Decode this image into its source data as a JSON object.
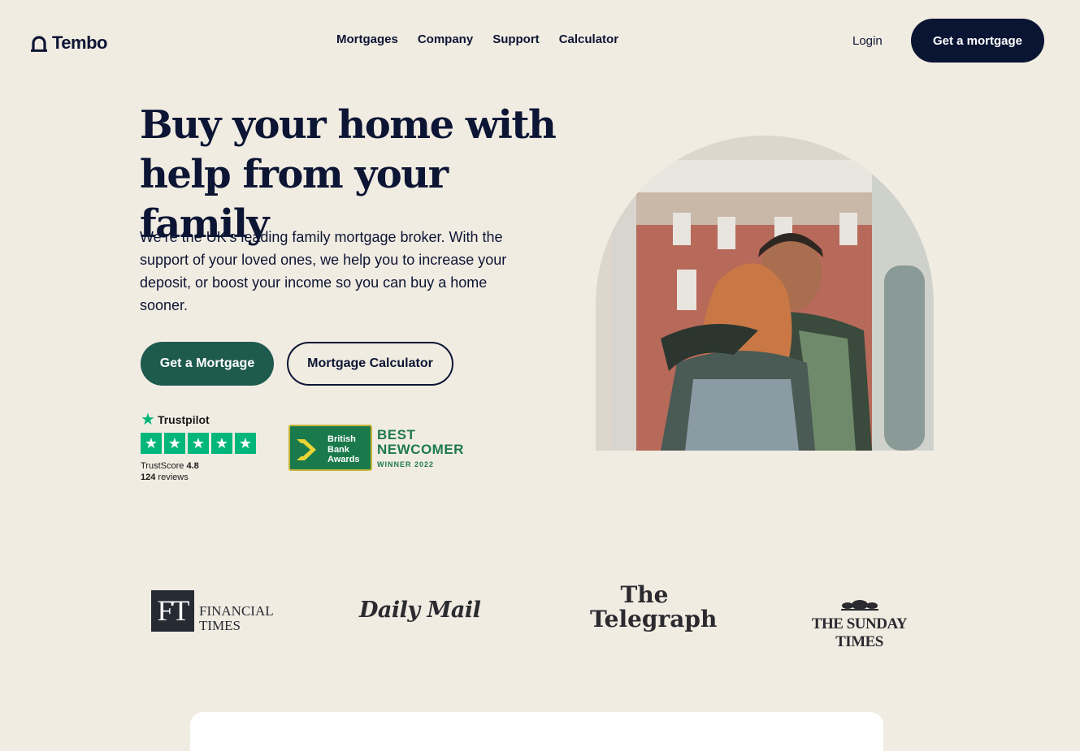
{
  "header": {
    "logo_text": "Tembo",
    "nav": [
      "Mortgages",
      "Company",
      "Support",
      "Calculator"
    ],
    "login_label": "Login",
    "cta_label": "Get a mortgage"
  },
  "hero": {
    "title": "Buy your home with help from your family",
    "description": "We’re the UK’s leading family mortgage broker. With the support of your loved ones, we help you to increase your deposit, or boost your income so you can buy a home sooner.",
    "primary_button": "Get a Mortgage",
    "secondary_button": "Mortgage Calculator",
    "image_alt_icon": "couple-hugging-photo"
  },
  "trustpilot": {
    "brand": "Trustpilot",
    "score_label": "TrustScore",
    "score": "4.8",
    "reviews_count": "124",
    "reviews_label": "reviews",
    "stars": 5
  },
  "award": {
    "badge_line1": "British",
    "badge_line2": "Bank",
    "badge_line3": "Awards",
    "title_line1": "BEST",
    "title_line2": "NEWCOMER",
    "subtitle": "WINNER 2022"
  },
  "press": {
    "ft_abbr": "FT",
    "ft_line1": "FINANCIAL",
    "ft_line2": "TIMES",
    "dailymail": "Daily Mail",
    "telegraph_line1": "The",
    "telegraph_line2": "Telegraph",
    "sundaytimes": "THE SUNDAY TIMES"
  },
  "colors": {
    "background": "#f1ece2",
    "navy": "#0a1433",
    "green": "#1e5a4e",
    "trustpilot_green": "#00b67a"
  }
}
